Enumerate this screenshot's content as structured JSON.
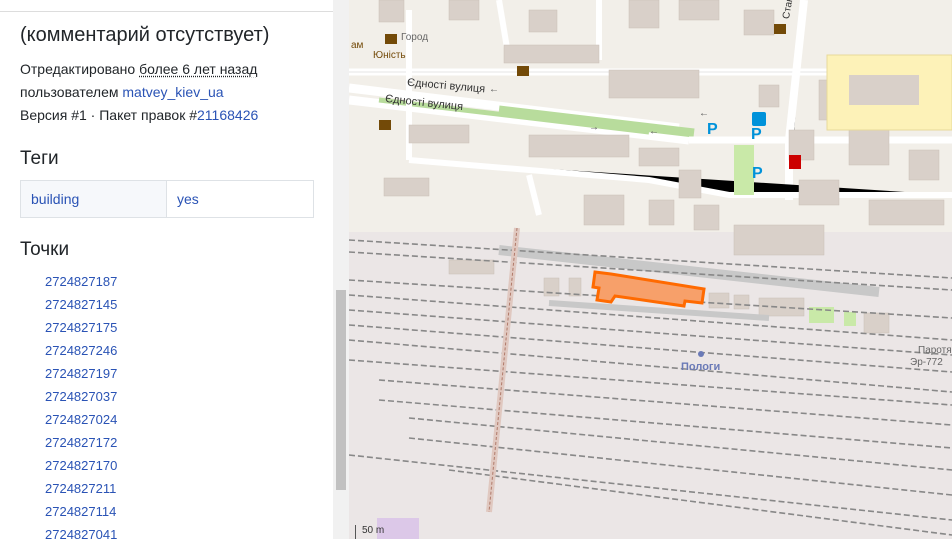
{
  "sidebar": {
    "comment": "(комментарий отсутствует)",
    "edited_prefix": "Отредактировано",
    "edited_time": "более 6 лет назад",
    "by_prefix": "пользователем",
    "user": "matvey_kiev_ua",
    "version": "Версия #1",
    "sep": "·",
    "changeset_prefix": "Пакет правок #",
    "changeset": "21168426",
    "tags_heading": "Теги",
    "tag_key": "building",
    "tag_value": "yes",
    "nodes_heading": "Точки",
    "nodes": [
      "2724827187",
      "2724827145",
      "2724827175",
      "2724827246",
      "2724827197",
      "2724827037",
      "2724827024",
      "2724827172",
      "2724827170",
      "2724827211",
      "2724827114",
      "2724827041"
    ]
  },
  "map": {
    "labels": {
      "street1": "Єдності вулиця",
      "street2": "Єдності вулиця",
      "station": "Пологи",
      "town": "Город",
      "cinema": "Юність",
      "cinema2": "ам",
      "street_vertical": "Станційна",
      "right_label": "Паротяг",
      "right_label2": "Эр-772",
      "parking": "P",
      "scale": "50 m"
    },
    "colors": {
      "land": "#f2efe9",
      "highlight": "#ff7f2a",
      "building": "#d9d0c9"
    }
  }
}
